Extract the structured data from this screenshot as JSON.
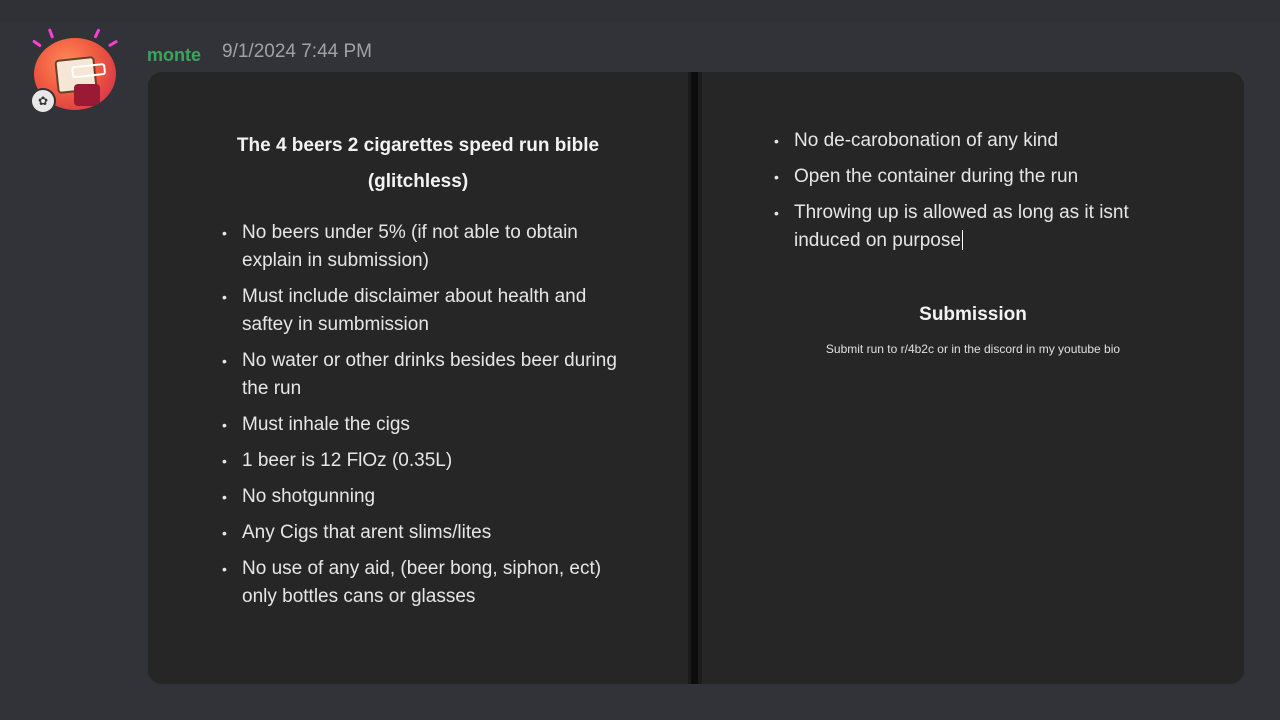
{
  "message": {
    "username": "monte",
    "timestamp": "9/1/2024 7:44 PM"
  },
  "document": {
    "title_line1": "The 4 beers 2 cigarettes speed run bible",
    "title_line2": "(glitchless)",
    "left_rules": [
      "No beers under 5% (if not able to obtain explain in submission)",
      "Must include disclaimer about health and saftey in sumbmission",
      "No water or other drinks besides beer during the run",
      "Must inhale the cigs",
      "1 beer is 12 FlOz (0.35L)",
      "No shotgunning",
      "Any Cigs that arent slims/lites",
      "No use of any aid, (beer bong, siphon, ect) only bottles cans or glasses"
    ],
    "right_rules": [
      "No de-carobonation of any kind",
      "Open the container during the run",
      "Throwing up is allowed as long as it isnt induced on purpose"
    ],
    "submission_heading": "Submission",
    "submission_text": "Submit run to r/4b2c or in the discord in my youtube bio"
  },
  "icons": {
    "bullet": "•"
  },
  "colors": {
    "background": "#313338",
    "username": "#3ba55d",
    "timestamp": "#9fa3a8",
    "document_bg": "#262626"
  }
}
